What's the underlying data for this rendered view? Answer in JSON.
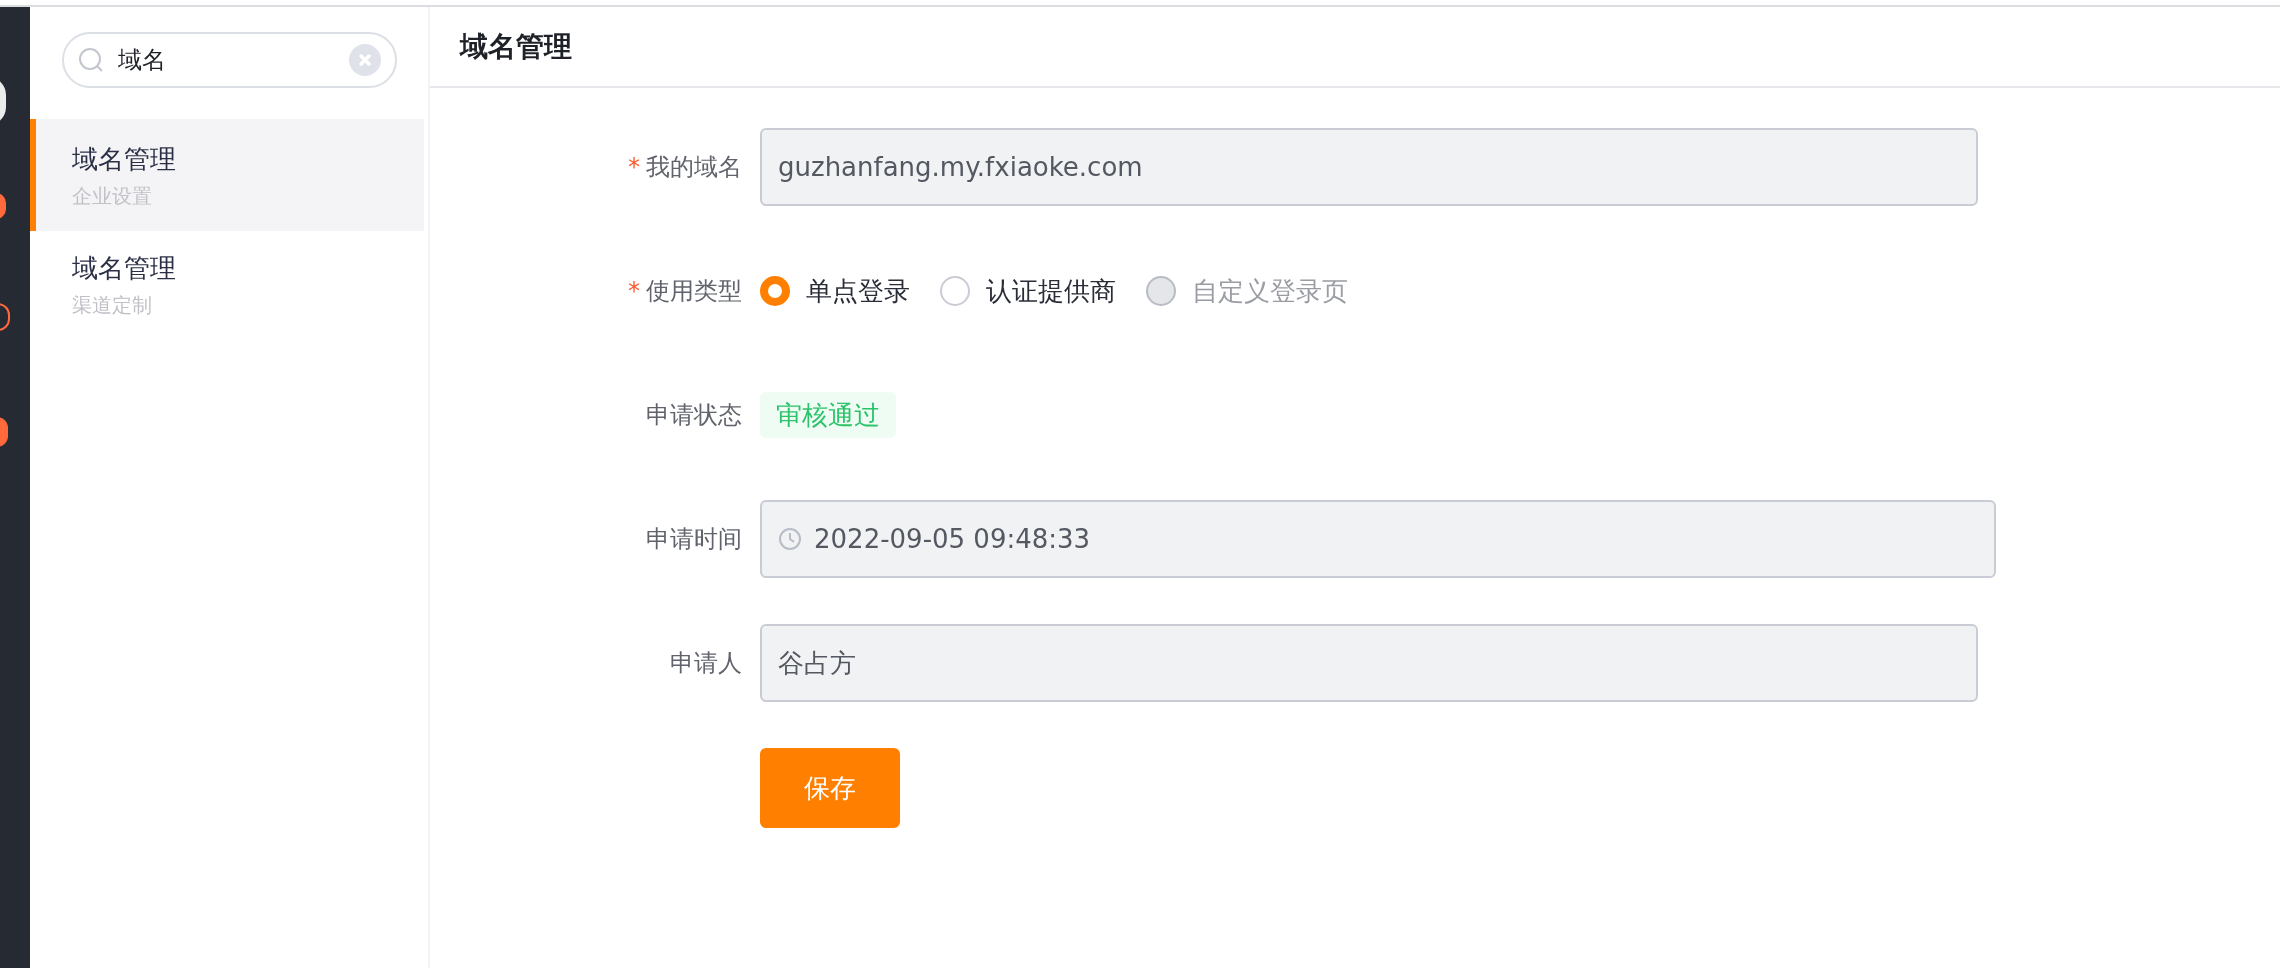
{
  "search": {
    "value": "域名"
  },
  "sidebar": {
    "items": [
      {
        "title": "域名管理",
        "subtitle": "企业设置",
        "selected": true
      },
      {
        "title": "域名管理",
        "subtitle": "渠道定制",
        "selected": false
      }
    ]
  },
  "header": {
    "title": "域名管理"
  },
  "form": {
    "fields": [
      {
        "kind": "input",
        "required": "*",
        "label": "我的域名",
        "value": "guzhanfang.my.fxiaoke.com"
      },
      {
        "kind": "radio",
        "required": "*",
        "label": "使用类型",
        "options": [
          {
            "label": "单点登录",
            "selected": true,
            "disabled": false
          },
          {
            "label": "认证提供商",
            "selected": false,
            "disabled": false
          },
          {
            "label": "自定义登录页",
            "selected": false,
            "disabled": true
          }
        ]
      },
      {
        "kind": "tag",
        "label": "申请状态",
        "value": "审核通过"
      },
      {
        "kind": "time",
        "label": "申请时间",
        "value": "2022-09-05 09:48:33"
      },
      {
        "kind": "input",
        "label": "申请人",
        "value": "谷占方"
      }
    ],
    "save_button": "保存"
  }
}
